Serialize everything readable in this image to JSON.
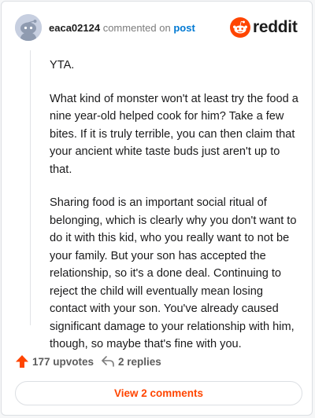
{
  "comment": {
    "username": "eaca02124",
    "action_text": "commented on",
    "target": "post",
    "paragraphs": [
      "YTA.",
      "What kind of monster won't at least try the food a nine year-old helped cook for him? Take a few bites. If it is truly terrible, you can then claim that your ancient white taste buds just aren't up to that.",
      "Sharing food is an important social ritual of belonging, which is clearly why you don't want to do it with this kid, who you really want to not be your family. But your son has accepted the relationship, so it's a done deal. Continuing to reject the child will eventually mean losing contact with your son. You've already caused significant damage to your relationship with him, though, so maybe that's fine with you."
    ]
  },
  "brand": {
    "name": "reddit",
    "color": "#ff4500",
    "icon": "reddit-snoo-icon"
  },
  "actions": {
    "upvotes": "177 upvotes",
    "replies": "2 replies",
    "upvote_icon": "upvote-arrow-icon",
    "reply_icon": "reply-arrow-icon"
  },
  "view_comments_label": "View 2 comments"
}
